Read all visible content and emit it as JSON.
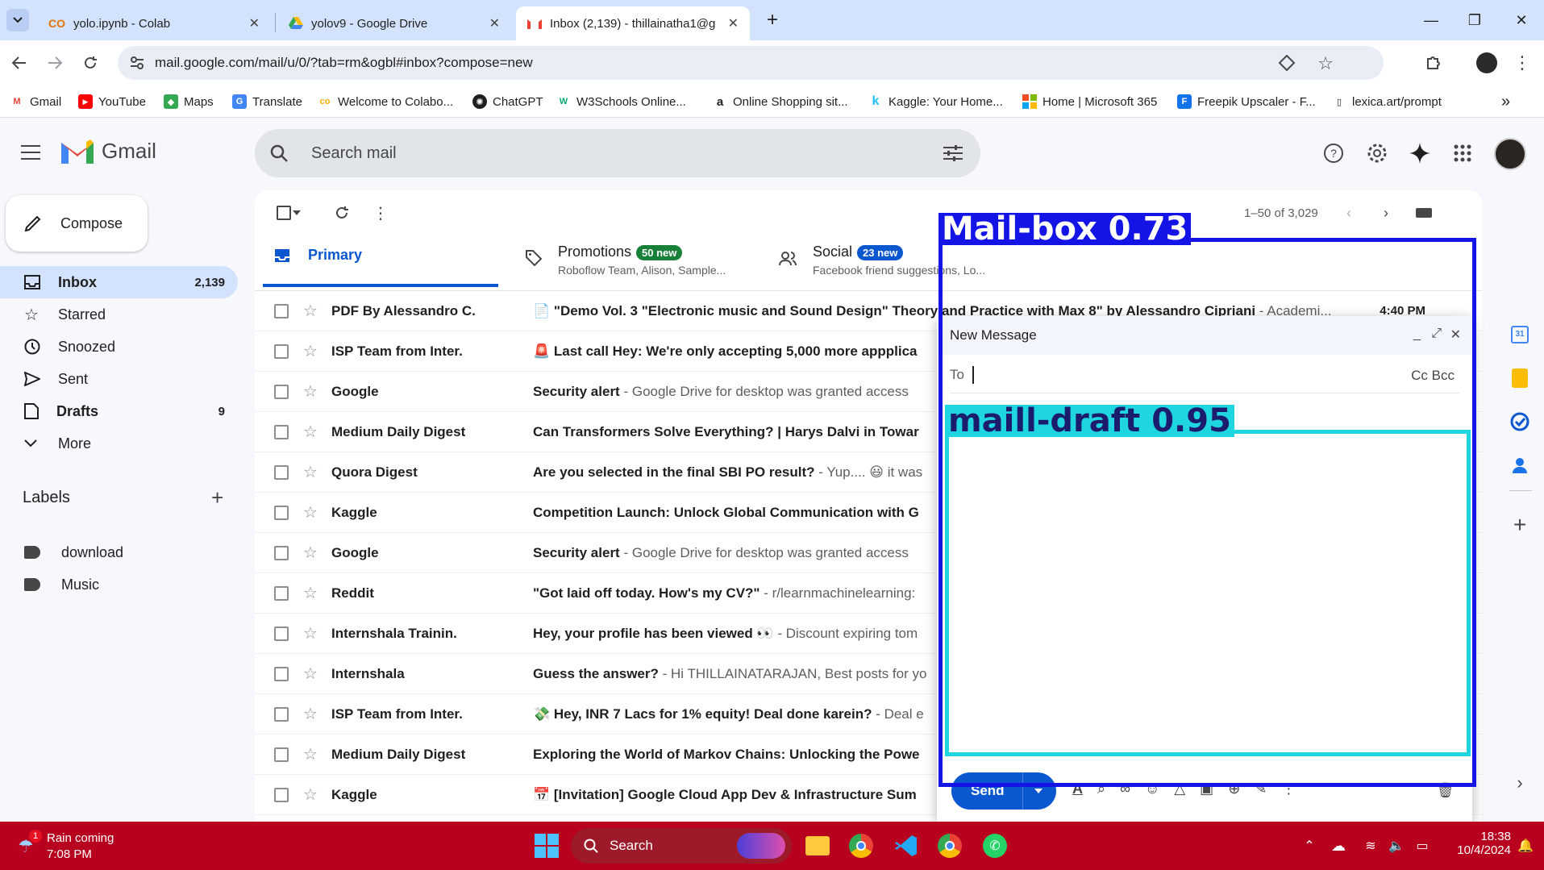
{
  "browser": {
    "tabs": [
      {
        "title": "yolo.ipynb - Colab",
        "icon": "colab-icon"
      },
      {
        "title": "yolov9 - Google Drive",
        "icon": "drive-icon"
      },
      {
        "title": "Inbox (2,139) - thillainatha1@g",
        "icon": "gmail-icon"
      }
    ],
    "new_tab": "+",
    "url": "mail.google.com/mail/u/0/?tab=rm&ogbl#inbox?compose=new",
    "bookmarks": [
      {
        "label": "Gmail",
        "color": "#ea4335",
        "glyph": "M"
      },
      {
        "label": "YouTube",
        "color": "#ff0000",
        "glyph": "▶"
      },
      {
        "label": "Maps",
        "color": "#34a853",
        "glyph": "◆"
      },
      {
        "label": "Translate",
        "color": "#4285f4",
        "glyph": "G"
      },
      {
        "label": "Welcome to Colabo...",
        "color": "#f9ab00",
        "glyph": "co"
      },
      {
        "label": "ChatGPT",
        "color": "#1f1f1f",
        "glyph": "✺"
      },
      {
        "label": "W3Schools Online...",
        "color": "#04aa6d",
        "glyph": "W"
      },
      {
        "label": "Online Shopping sit...",
        "color": "#ffffff",
        "glyph": "a"
      },
      {
        "label": "Kaggle: Your Home...",
        "color": "#20beff",
        "glyph": "k"
      },
      {
        "label": "Home | Microsoft 365",
        "color": "#f25022",
        "glyph": "■"
      },
      {
        "label": "Freepik Upscaler - F...",
        "color": "#1273eb",
        "glyph": "F"
      },
      {
        "label": "lexica.art/prompt",
        "color": "#ffffff",
        "glyph": "▯"
      }
    ],
    "more_bookmarks": "»"
  },
  "gmail": {
    "logo_text": "Gmail",
    "search_placeholder": "Search mail",
    "compose_label": "Compose",
    "nav": [
      {
        "label": "Inbox",
        "count": "2,139",
        "icon": "inbox-icon"
      },
      {
        "label": "Starred",
        "count": "",
        "icon": "star-icon"
      },
      {
        "label": "Snoozed",
        "count": "",
        "icon": "clock-icon"
      },
      {
        "label": "Sent",
        "count": "",
        "icon": "send-icon"
      },
      {
        "label": "Drafts",
        "count": "9",
        "icon": "draft-icon"
      },
      {
        "label": "More",
        "count": "",
        "icon": "chevron-down-icon"
      }
    ],
    "labels_title": "Labels",
    "labels": [
      "download",
      "Music"
    ],
    "pagination": "1–50 of 3,029",
    "categories": [
      {
        "title": "Primary",
        "sub": "",
        "badge": ""
      },
      {
        "title": "Promotions",
        "sub": "Roboflow Team, Alison, Sample...",
        "badge": "50 new",
        "badge_color": "#188038"
      },
      {
        "title": "Social",
        "sub": "Facebook friend suggestions, Lo...",
        "badge": "23 new",
        "badge_color": "#0b57d0"
      }
    ],
    "emails": [
      {
        "sender": "PDF By Alessandro C.",
        "subject": "📄 \"Demo Vol. 3 \"Electronic music and Sound Design\" Theory and Practice with Max 8\" by Alessandro Cipriani",
        "snippet": " - Academi...",
        "time": "4:40 PM"
      },
      {
        "sender": "ISP Team from Inter.",
        "subject": "🚨 Last call Hey: We're only accepting 5,000 more appplica",
        "snippet": "",
        "time": ""
      },
      {
        "sender": "Google",
        "subject": "Security alert",
        "snippet": " - Google Drive for desktop was granted access",
        "time": ""
      },
      {
        "sender": "Medium Daily Digest",
        "subject": "Can Transformers Solve Everything? | Harys Dalvi in Towar",
        "snippet": "",
        "time": ""
      },
      {
        "sender": "Quora Digest",
        "subject": "Are you selected in the final SBI PO result?",
        "snippet": " - Yup.... 😃 it was",
        "time": ""
      },
      {
        "sender": "Kaggle",
        "subject": "Competition Launch: Unlock Global Communication with G",
        "snippet": "",
        "time": ""
      },
      {
        "sender": "Google",
        "subject": "Security alert",
        "snippet": " - Google Drive for desktop was granted access",
        "time": ""
      },
      {
        "sender": "Reddit",
        "subject": "\"Got laid off today. How's my CV?\"",
        "snippet": " - r/learnmachinelearning:",
        "time": ""
      },
      {
        "sender": "Internshala Trainin.",
        "subject": "Hey, your profile has been viewed 👀",
        "snippet": " - Discount expiring tom",
        "time": ""
      },
      {
        "sender": "Internshala",
        "subject": "Guess the answer?",
        "snippet": " - Hi THILLAINATARAJAN, Best posts for yo",
        "time": ""
      },
      {
        "sender": "ISP Team from Inter.",
        "subject": "💸 Hey, INR 7 Lacs for 1% equity! Deal done karein?",
        "snippet": " - Deal e",
        "time": ""
      },
      {
        "sender": "Medium Daily Digest",
        "subject": "Exploring the World of Markov Chains: Unlocking the Powe",
        "snippet": "",
        "time": ""
      },
      {
        "sender": "Kaggle",
        "subject": "📅 [Invitation] Google Cloud App Dev & Infrastructure Sum",
        "snippet": "",
        "time": ""
      }
    ],
    "compose": {
      "title": "New Message",
      "to_label": "To",
      "cc_bcc": "Cc Bcc",
      "send_label": "Send"
    }
  },
  "detections": [
    {
      "label": "Mail-box 0.73"
    },
    {
      "label": "maill-draft 0.95"
    }
  ],
  "taskbar": {
    "weather_title": "Rain coming",
    "weather_time": "7:08 PM",
    "weather_badge": "1",
    "search_label": "Search",
    "clock_time": "18:38",
    "clock_date": "10/4/2024"
  }
}
